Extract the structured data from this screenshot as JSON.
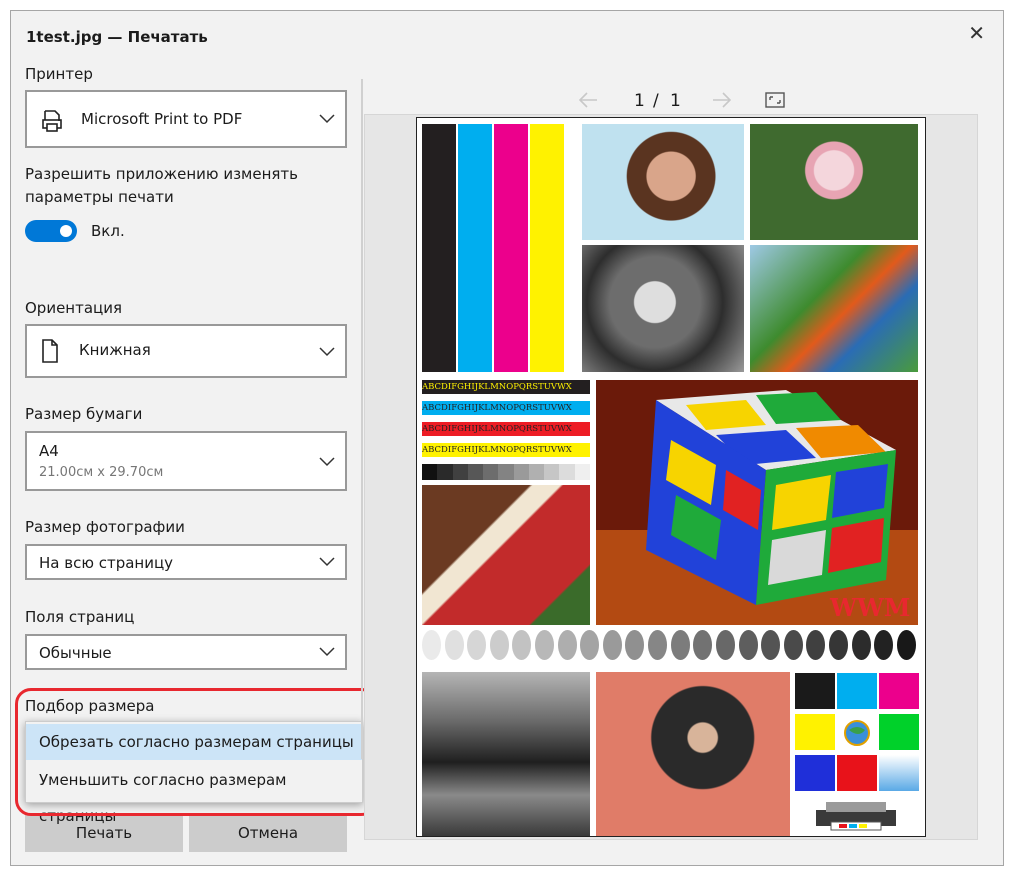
{
  "dialog": {
    "title": "1test.jpg — Печатать"
  },
  "printer": {
    "label": "Принтер",
    "value": "Microsoft Print to PDF",
    "icon": "printer-icon"
  },
  "app_settings": {
    "label": "Разрешить приложению изменять параметры печати",
    "toggle_state": "Вкл."
  },
  "orientation": {
    "label": "Ориентация",
    "value": "Книжная",
    "icon": "page-portrait-icon"
  },
  "paper_size": {
    "label": "Размер бумаги",
    "value": "A4",
    "sub_value": "21.00см x 29.70см"
  },
  "photo_size": {
    "label": "Размер фотографии",
    "value": "На всю страницу"
  },
  "margins": {
    "label": "Поля страниц",
    "value": "Обычные"
  },
  "fit": {
    "label": "Подбор размера",
    "options": [
      "Обрезать согласно размерам страницы",
      "Уменьшить согласно размерам страницы"
    ]
  },
  "buttons": {
    "print": "Печать",
    "cancel": "Отмена"
  },
  "preview": {
    "page_current": "1",
    "page_sep": "/",
    "page_total": "1",
    "alphabet": "ABCDIFGHIJKLMNOPQRSTUVWX",
    "watermark": "WWM"
  },
  "colors": {
    "accent": "#0078d7",
    "highlight_ring": "#e8282f",
    "selected_option": "#cce4f7"
  }
}
